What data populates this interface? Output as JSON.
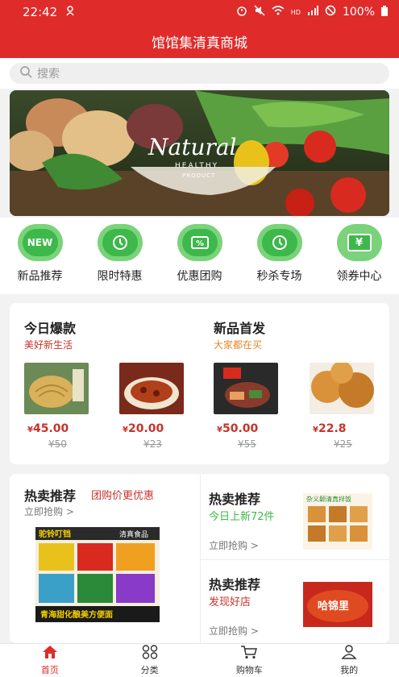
{
  "status_bar": {
    "time": "22:42",
    "battery": "100%"
  },
  "navbar": {
    "title": "馆馆集清真商城"
  },
  "search": {
    "placeholder": "搜索"
  },
  "banner": {
    "headline": "Natural",
    "subline": "HEALTHY",
    "tag": "PRODUCT"
  },
  "quick_menu": [
    {
      "label": "新品推荐",
      "icon": "new-icon",
      "icon_text": "NEW"
    },
    {
      "label": "限时特惠",
      "icon": "clock-icon",
      "icon_text": ""
    },
    {
      "label": "优惠团购",
      "icon": "coupon-icon",
      "icon_text": ""
    },
    {
      "label": "秒杀专场",
      "icon": "clock-icon",
      "icon_text": ""
    },
    {
      "label": "领券中心",
      "icon": "yen-ticket-icon",
      "icon_text": "¥"
    }
  ],
  "today": {
    "title": "今日爆款",
    "subtitle": "美好新生活"
  },
  "new_release": {
    "title": "新品首发",
    "subtitle": "大家都在买"
  },
  "products": [
    {
      "price": "45.00",
      "old": "¥50"
    },
    {
      "price": "20.00",
      "old": "¥23"
    },
    {
      "price": "50.00",
      "old": "¥55"
    },
    {
      "price": "22.8",
      "old": "¥25"
    }
  ],
  "hot_left": {
    "title": "热卖推荐",
    "tag": "团购价更优惠",
    "link": "立即抢购 >",
    "img_top": "驼铃叮铛",
    "img_right": "清真食品",
    "img_bottom": "青海甜化酿美方便面"
  },
  "hot_right_1": {
    "title": "热卖推荐",
    "subtitle": "今日上新72件",
    "link": "立即抢购 >",
    "img_label": "杂义颡清真拌饭"
  },
  "hot_right_2": {
    "title": "热卖推荐",
    "subtitle": "发现好店",
    "link": "立即抢购 >",
    "img_label": "哈锦里"
  },
  "currency": "¥",
  "tabs": [
    {
      "label": "首页",
      "icon": "home-icon"
    },
    {
      "label": "分类",
      "icon": "category-icon"
    },
    {
      "label": "购物车",
      "icon": "cart-icon"
    },
    {
      "label": "我的",
      "icon": "user-icon"
    }
  ],
  "colors": {
    "brand_red": "#e02b2b",
    "price_red": "#c8322b",
    "green": "#3db84a",
    "orange": "#e6872a"
  }
}
